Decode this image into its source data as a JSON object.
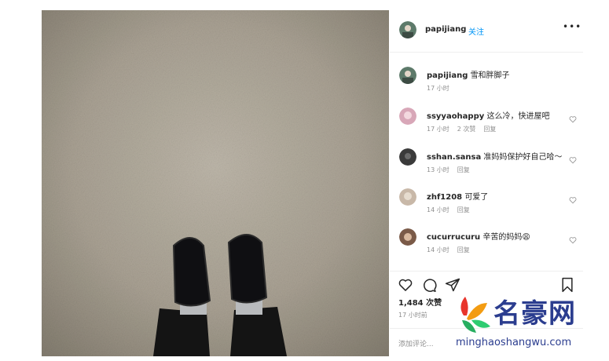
{
  "post": {
    "author": "papijiang",
    "follow_label": "关注",
    "more_icon": "more-horizontal-icon"
  },
  "comments": [
    {
      "user": "papijiang",
      "text": "雪和胖脚子",
      "time": "17 小时",
      "likes": "",
      "reply": "",
      "avatar_color": "#5d7a6a"
    },
    {
      "user": "ssyyaohappy",
      "text": "这么冷，快进屋吧",
      "time": "17 小时",
      "likes": "2 次赞",
      "reply": "回复",
      "avatar_color": "#d8a7b8"
    },
    {
      "user": "sshan.sansa",
      "text": "准妈妈保护好自己哈～",
      "time": "13 小时",
      "likes": "",
      "reply": "回复",
      "avatar_color": "#3a3a3a"
    },
    {
      "user": "zhf1208",
      "text": "可爱了",
      "time": "14 小时",
      "likes": "",
      "reply": "回复",
      "avatar_color": "#c8b8a8"
    },
    {
      "user": "cucurrucuru",
      "text": "辛苦的妈妈😩",
      "time": "14 小时",
      "likes": "",
      "reply": "回复",
      "avatar_color": "#7a5a48"
    }
  ],
  "actions": {
    "likes_count": "1,484 次赞",
    "post_time": "17 小时前",
    "add_comment_placeholder": "添加评论..."
  },
  "watermark": {
    "brand": "名豪网",
    "url": "minghaoshangwu.com"
  },
  "colors": {
    "link_blue": "#0095f6",
    "muted_gray": "#8e8e8e",
    "border": "#efefef",
    "watermark_blue": "#2b3d8f"
  }
}
